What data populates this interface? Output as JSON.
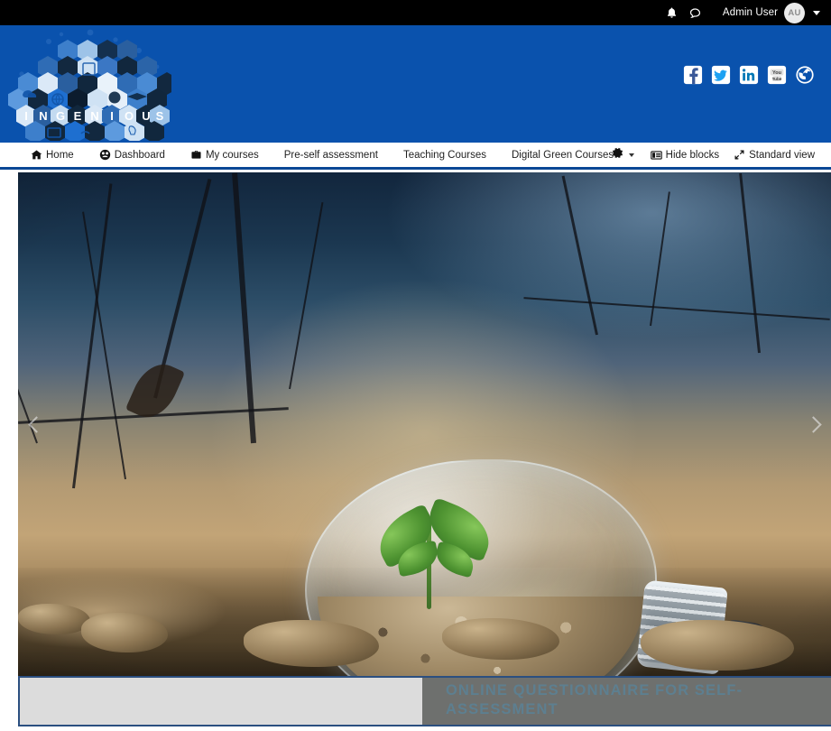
{
  "topbar": {
    "notifications_icon": "bell-icon",
    "messages_icon": "chat-bubble-icon",
    "user_name": "Admin User",
    "avatar_initials": "AU",
    "caret_icon": "chevron-down-icon"
  },
  "brand": {
    "logo_text": "INGENIOUS",
    "logo_letters": [
      "I",
      "N",
      "G",
      "E",
      "N",
      "I",
      "O",
      "U",
      "S"
    ],
    "logo_icons": [
      "cloud-icon",
      "globe-icon",
      "network-icon",
      "graduation-cap-icon",
      "mouse-icon",
      "handshake-icon",
      "gears-icon",
      "monitor-icon",
      "wifi-icon",
      "lightbulb-icon"
    ],
    "header_color": "#0a52ad",
    "social": [
      {
        "name": "facebook-icon",
        "label": "Facebook"
      },
      {
        "name": "twitter-icon",
        "label": "Twitter"
      },
      {
        "name": "linkedin-icon",
        "label": "LinkedIn"
      },
      {
        "name": "youtube-icon",
        "label": "YouTube"
      },
      {
        "name": "globe-icon",
        "label": "Website"
      }
    ]
  },
  "nav": {
    "items": [
      {
        "label": "Home",
        "icon": "home-icon"
      },
      {
        "label": "Dashboard",
        "icon": "dashboard-icon"
      },
      {
        "label": "My courses",
        "icon": "briefcase-icon"
      },
      {
        "label": "Pre-self assessment",
        "icon": ""
      },
      {
        "label": "Teaching Courses",
        "icon": ""
      },
      {
        "label": "Digital Green Courses",
        "icon": ""
      }
    ],
    "right_items": [
      {
        "label": "",
        "icon": "gear-icon",
        "has_caret": true
      },
      {
        "label": "Hide blocks",
        "icon": "blocks-icon",
        "has_caret": false
      },
      {
        "label": "Standard view",
        "icon": "expand-icon",
        "has_caret": false
      }
    ],
    "accent_color": "#0a4795"
  },
  "carousel": {
    "prev_icon": "chevron-left-icon",
    "next_icon": "chevron-right-icon",
    "slide_alt": "lightbulb-with-seedling-on-dry-soil",
    "caption_title": "ONLINE QUESTIONNAIRE FOR SELF-ASSESSMENT",
    "caption_panel_color": "#6e706e",
    "caption_left_color": "#dcdcdc",
    "caption_text_color": "#5d7f90"
  }
}
